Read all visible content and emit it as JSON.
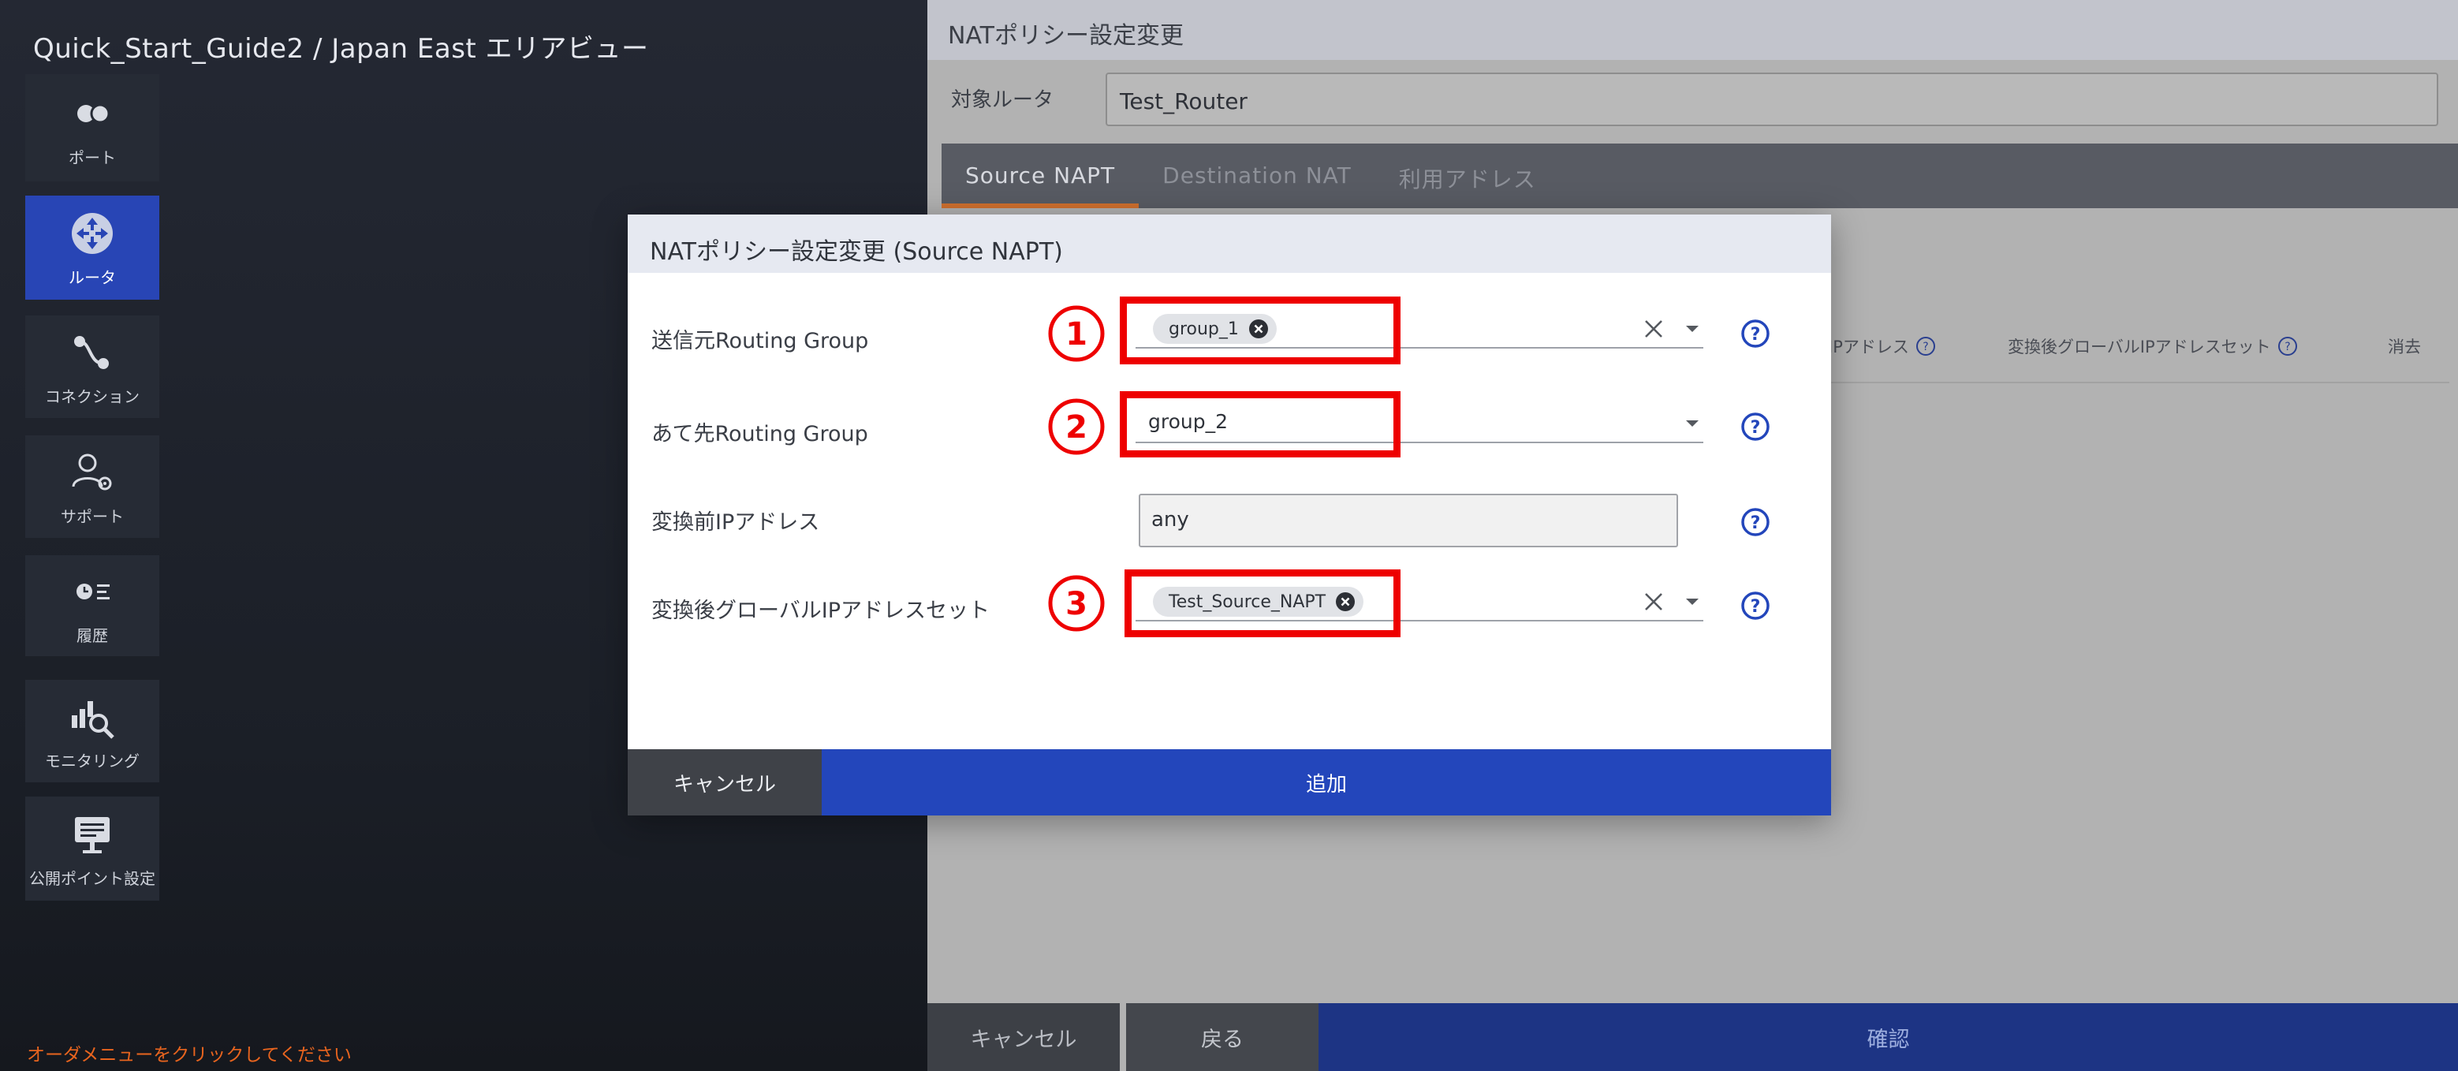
{
  "sidebar": {
    "area_title": "Quick_Start_Guide2 / Japan East エリアビュー",
    "items": [
      {
        "label": "ポート",
        "icon": "port-icon"
      },
      {
        "label": "ルータ",
        "icon": "router-icon",
        "active": true
      },
      {
        "label": "コネクション",
        "icon": "connection-icon"
      },
      {
        "label": "サポート",
        "icon": "support-icon"
      },
      {
        "label": "履歴",
        "icon": "history-icon"
      },
      {
        "label": "モニタリング",
        "icon": "monitoring-icon"
      },
      {
        "label": "公開ポイント設定",
        "icon": "public-point-icon"
      }
    ],
    "order_hint": "オーダメニューをクリックしてください"
  },
  "panel": {
    "title": "NATポリシー設定変更",
    "target_router_label": "対象ルータ",
    "target_router_value": "Test_Router",
    "tabs": [
      {
        "label": "Source NAPT",
        "active": true
      },
      {
        "label": "Destination NAT"
      },
      {
        "label": "利用アドレス"
      }
    ],
    "columns": [
      {
        "label": "IPアドレス",
        "help": true
      },
      {
        "label": "変換後グローバルIPアドレスセット",
        "help": true
      },
      {
        "label": "消去",
        "help": false
      }
    ],
    "buttons": {
      "cancel": "キャンセル",
      "back": "戻る",
      "confirm": "確認"
    }
  },
  "modal": {
    "title": "NATポリシー設定変更 (Source NAPT)",
    "fields": {
      "source_group": {
        "label": "送信元Routing Group",
        "chip": "group_1"
      },
      "dest_group": {
        "label": "あて先Routing Group",
        "value": "group_2"
      },
      "pre_ip": {
        "label": "変換前IPアドレス",
        "value": "any"
      },
      "global_ip_set": {
        "label": "変換後グローバルIPアドレスセット",
        "chip": "Test_Source_NAPT"
      }
    },
    "buttons": {
      "cancel": "キャンセル",
      "add": "追加"
    }
  },
  "annotations": {
    "highlight_color": "#ee0000",
    "markers": [
      "1",
      "2",
      "3"
    ]
  },
  "colors": {
    "accent": "#2346bb",
    "active_nav": "#2845b5",
    "tab_underline": "#d0702e",
    "hint": "#e8641e"
  }
}
